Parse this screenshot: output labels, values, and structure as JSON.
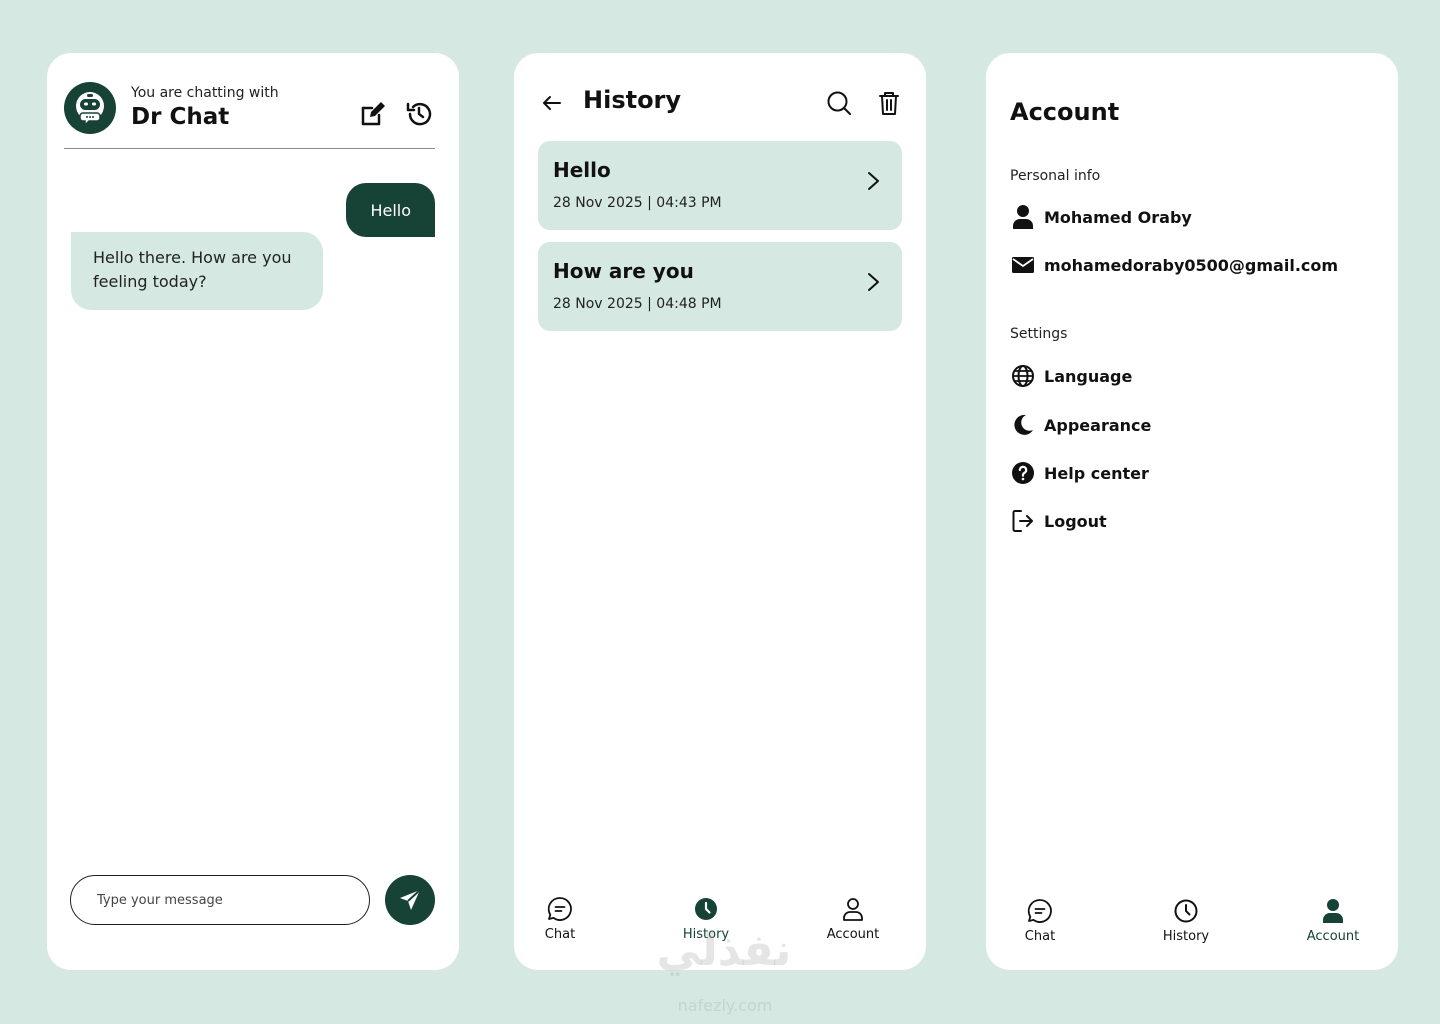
{
  "chat": {
    "subtitle": "You are chatting with",
    "bot_name": "Dr Chat",
    "messages": {
      "user": "Hello",
      "bot": "Hello there. How are you feeling today?"
    },
    "input_placeholder": "Type your message"
  },
  "history": {
    "title": "History",
    "items": [
      {
        "title": "Hello",
        "date": "28 Nov 2025 | 04:43 PM"
      },
      {
        "title": "How are you",
        "date": "28 Nov 2025 | 04:48 PM"
      }
    ]
  },
  "account": {
    "title": "Account",
    "personal_label": "Personal info",
    "name": "Mohamed Oraby",
    "email": "mohamedoraby0500@gmail.com",
    "settings_label": "Settings",
    "settings": {
      "language": "Language",
      "appearance": "Appearance",
      "help": "Help center",
      "logout": "Logout"
    }
  },
  "nav": {
    "chat": "Chat",
    "history": "History",
    "account": "Account"
  },
  "watermark": {
    "main": "نفذلي",
    "sub": "nafezly.com"
  },
  "colors": {
    "primary": "#174236",
    "accent_bg": "#d5e8e1",
    "surface": "#ffffff"
  }
}
